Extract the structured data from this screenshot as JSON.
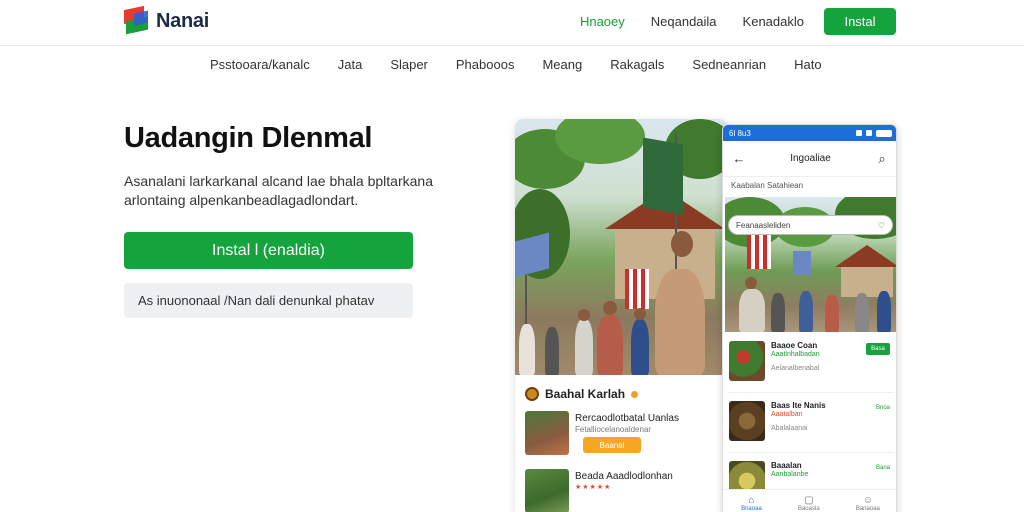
{
  "brand": {
    "name": "Nanai"
  },
  "top_nav": {
    "items": [
      {
        "label": "Hnaoey",
        "active": true
      },
      {
        "label": "Neqandaila",
        "active": false
      },
      {
        "label": "Kenadaklo",
        "active": false
      }
    ],
    "install_label": "Instal"
  },
  "sub_nav": [
    "Psstooara/kanalc",
    "Jata",
    "Slaper",
    "Phabooos",
    "Meang",
    "Rakagals",
    "Sedneanrian",
    "Hato"
  ],
  "hero": {
    "title": "Uadangin Dlenmal",
    "description": "Asanalani larkarkanal alcand lae bhala bpltarkana arlontaing alpenkanbeadlagadlondart.",
    "install_button": "Instal l (enaldia)",
    "secondary_button": "As inuononaal /Nan dali denunkal phatav"
  },
  "left_phone": {
    "section_title": "Baahal Karlah",
    "items": [
      {
        "title": "Rercaodlotbatal Uanlas",
        "subtitle": "Fetalliocelanoaldenar",
        "button": "Baanal"
      },
      {
        "title": "Beada Aaadlodlonhan",
        "subtitle": ""
      }
    ]
  },
  "right_phone": {
    "status_time": "6l 8u3",
    "title": "Ingoaliae",
    "subtitle": "Kaabalan Satahiean",
    "search_placeholder": "Feanaasleliden",
    "items": [
      {
        "title": "Baaoe Coan",
        "subtitle": "Aaatlnhalbadan",
        "meta": "Aelanalbenabal",
        "tag": "Basa"
      },
      {
        "title": "Baas Ite Nanis",
        "subtitle": "Aaatalban",
        "meta": "Abalalaanai",
        "tag": "Bnoa"
      },
      {
        "title": "Baaalan",
        "subtitle": "Aanbalanbe",
        "meta": "",
        "tag": "Bana"
      }
    ],
    "tabs": [
      {
        "label": "Bnaoaa",
        "active": true
      },
      {
        "label": "Baoasla",
        "active": false
      },
      {
        "label": "Banaoaa",
        "active": false
      }
    ]
  },
  "colors": {
    "accent_green": "#15a33d",
    "brand_blue": "#1e6ed8",
    "orange": "#f5a623"
  }
}
